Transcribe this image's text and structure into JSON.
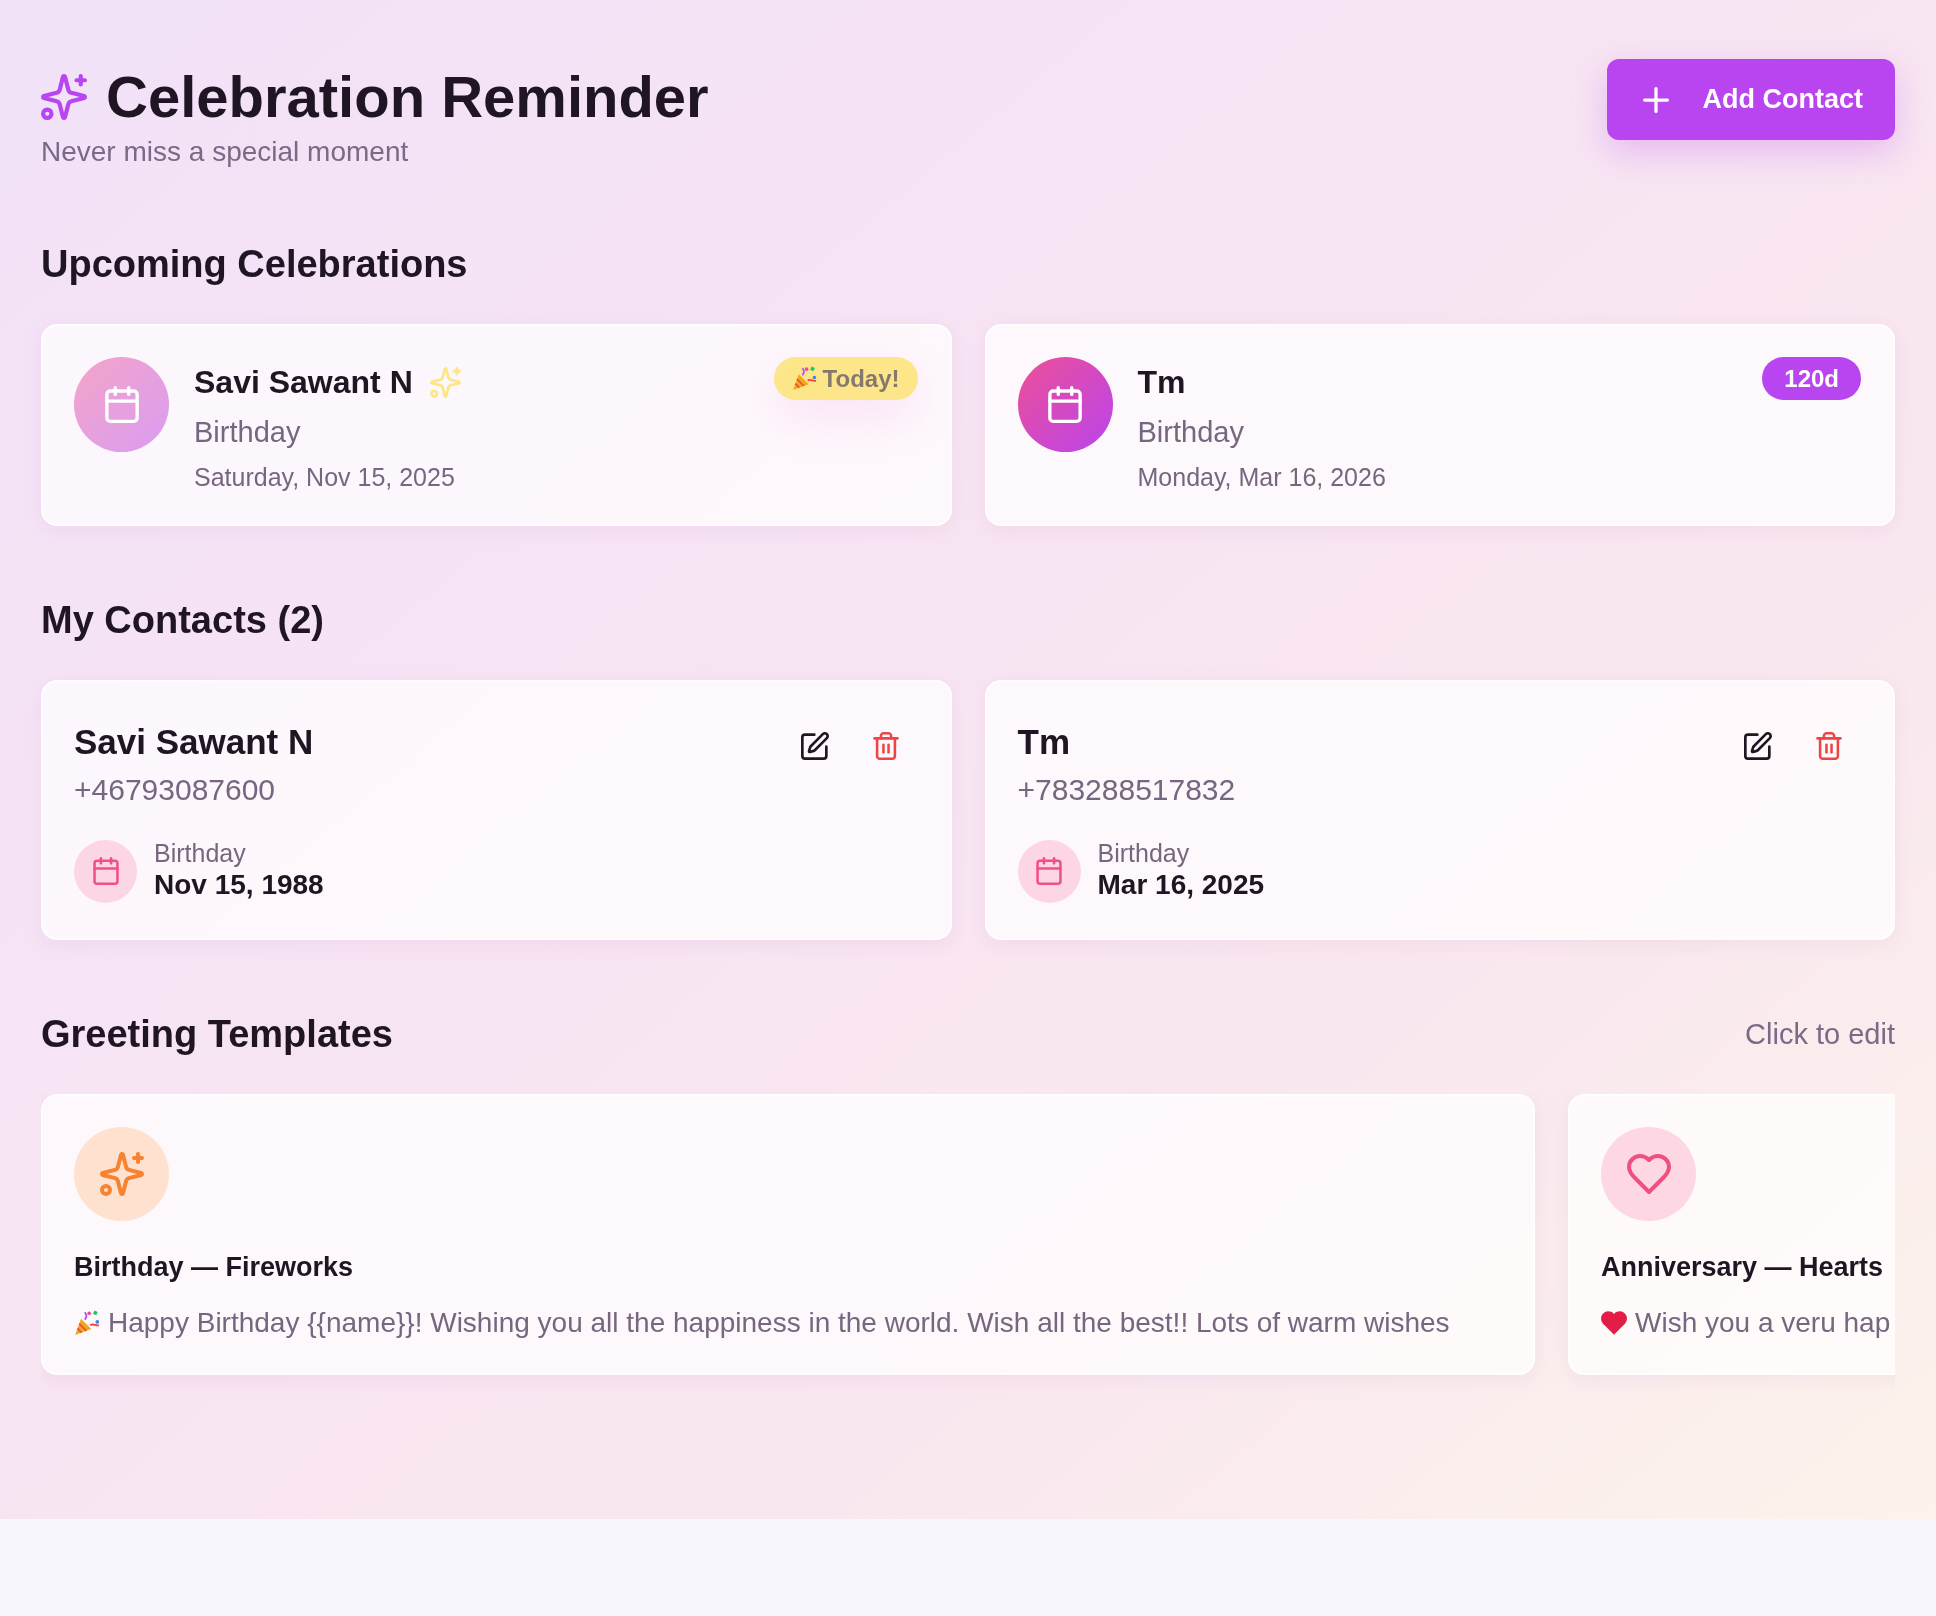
{
  "header": {
    "title": "Celebration Reminder",
    "subtitle": "Never miss a special moment",
    "add_button": "Add Contact"
  },
  "upcoming": {
    "heading": "Upcoming Celebrations",
    "items": [
      {
        "name": "Savi Sawant N",
        "event": "Birthday",
        "date": "Saturday, Nov 15, 2025",
        "today": true,
        "badge": "Today!"
      },
      {
        "name": "Tm",
        "event": "Birthday",
        "date": "Monday, Mar 16, 2026",
        "today": false,
        "badge": "120d"
      }
    ]
  },
  "contacts": {
    "heading": "My Contacts (2)",
    "items": [
      {
        "name": "Savi Sawant N",
        "phone": "+46793087600",
        "event": "Birthday",
        "date": "Nov 15, 1988"
      },
      {
        "name": "Tm",
        "phone": "+783288517832",
        "event": "Birthday",
        "date": "Mar 16, 2025"
      }
    ]
  },
  "templates": {
    "heading": "Greeting Templates",
    "hint": "Click to edit",
    "items": [
      {
        "kind": "fireworks",
        "title": "Birthday — Fireworks",
        "message": "Happy Birthday {{name}}! Wishing you all the happiness in the world. Wish all the best!! Lots of warm wishes"
      },
      {
        "kind": "hearts",
        "title": "Anniversary — Hearts",
        "message": "Wish you a veru hap"
      }
    ]
  }
}
